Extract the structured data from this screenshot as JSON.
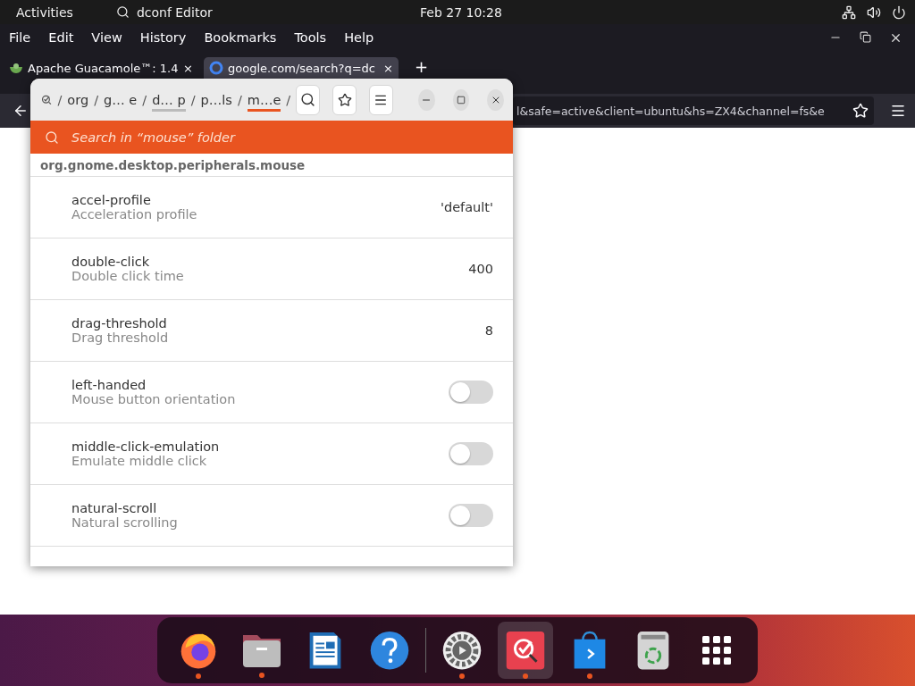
{
  "top_bar": {
    "activities": "Activities",
    "app_name": "dconf Editor",
    "clock": "Feb 27  10:28"
  },
  "menu_bar": [
    "File",
    "Edit",
    "View",
    "History",
    "Bookmarks",
    "Tools",
    "Help"
  ],
  "tabs": [
    {
      "label": "Apache Guacamole™: 1.4",
      "selected": false,
      "close": "×"
    },
    {
      "label": "google.com/search?q=dc",
      "selected": true,
      "close": "×"
    }
  ],
  "new_tab": "+",
  "url": "l&safe=active&client=ubuntu&hs=ZX4&channel=fs&e",
  "dconf": {
    "path": [
      {
        "kind": "sep",
        "text": "/"
      },
      {
        "kind": "seg",
        "text": "org",
        "selected": false,
        "trail": false
      },
      {
        "kind": "sep",
        "text": "/"
      },
      {
        "kind": "seg",
        "text": "g… e",
        "selected": false,
        "trail": false
      },
      {
        "kind": "sep",
        "text": "/"
      },
      {
        "kind": "seg",
        "text": "d… p",
        "selected": false,
        "trail": true
      },
      {
        "kind": "sep",
        "text": "/"
      },
      {
        "kind": "seg",
        "text": "p…ls",
        "selected": false,
        "trail": false
      },
      {
        "kind": "sep",
        "text": "/"
      },
      {
        "kind": "seg",
        "text": "m…e",
        "selected": true,
        "trail": false
      },
      {
        "kind": "sep",
        "text": "/"
      }
    ],
    "search": {
      "placeholder": "Search in “mouse” folder"
    },
    "schema": "org.gnome.desktop.peripherals.mouse",
    "keys": [
      {
        "name": "accel-profile",
        "summary": "Acceleration profile",
        "kind": "value",
        "value": "'default'"
      },
      {
        "name": "double-click",
        "summary": "Double click time",
        "kind": "value",
        "value": "400"
      },
      {
        "name": "drag-threshold",
        "summary": "Drag threshold",
        "kind": "value",
        "value": "8"
      },
      {
        "name": "left-handed",
        "summary": "Mouse button orientation",
        "kind": "toggle",
        "on": false
      },
      {
        "name": "middle-click-emulation",
        "summary": "Emulate middle click",
        "kind": "toggle",
        "on": false
      },
      {
        "name": "natural-scroll",
        "summary": "Natural scrolling",
        "kind": "toggle",
        "on": false
      }
    ]
  },
  "dock": [
    {
      "kind": "firefox",
      "running": true,
      "selected": false
    },
    {
      "kind": "files",
      "running": true,
      "selected": false
    },
    {
      "kind": "writer",
      "running": false,
      "selected": false
    },
    {
      "kind": "help",
      "running": false,
      "selected": false
    },
    {
      "kind": "separator"
    },
    {
      "kind": "settings",
      "running": true,
      "selected": false
    },
    {
      "kind": "dconf",
      "running": true,
      "selected": true
    },
    {
      "kind": "store",
      "running": true,
      "selected": false
    },
    {
      "kind": "trash",
      "running": false,
      "selected": false
    },
    {
      "kind": "grid",
      "running": false,
      "selected": false
    }
  ]
}
